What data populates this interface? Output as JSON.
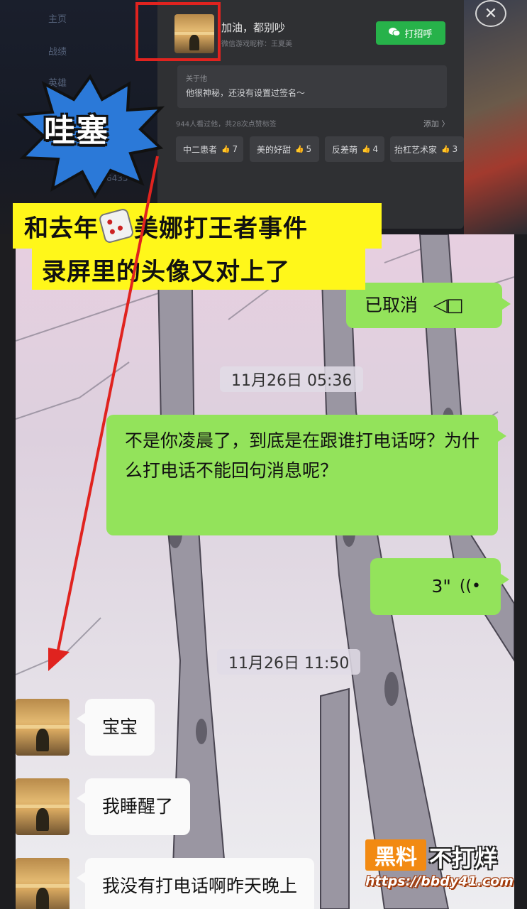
{
  "background_menu": [
    "主页",
    "战绩",
    "英雄"
  ],
  "background_number": "6435",
  "profile_popup": {
    "name": "加油，都别吵",
    "sub_label": "微信游戏昵称：王夏美",
    "greet_button": "打招呼",
    "about_title": "关于他",
    "about_text": "他很神秘，还没有设置过签名～",
    "visits_text": "944人看过他，共28次点赞标签",
    "add_link": "添加 〉",
    "tags": [
      {
        "label": "中二患者",
        "count": "7"
      },
      {
        "label": "美的好甜",
        "count": "5"
      },
      {
        "label": "反差萌",
        "count": "4"
      },
      {
        "label": "抬杠艺术家",
        "count": "3"
      }
    ],
    "close_symbol": "✕"
  },
  "sticker_text": "哇塞",
  "caption": {
    "line1_a": "和去年",
    "line1_b": "美娜打王者事件",
    "line2": "录屏里的头像又对上了"
  },
  "chat": {
    "cancelled_call": "已取消",
    "time1": "11月26日 05:36",
    "question_message": "不是你凌晨了，到底是在跟谁打电话呀？为什么打电话不能回句消息呢？",
    "voice_duration": "3\"",
    "time2": "11月26日 11:50",
    "incoming": [
      "宝宝",
      "我睡醒了",
      "我没有打电话啊昨天晚上"
    ]
  },
  "watermark": {
    "box": "黑料",
    "name": "不打烊",
    "url": "https://bbdy41.com"
  },
  "colors": {
    "green_bubble": "#93e35b",
    "highlight_red": "#e0231f",
    "caption_yellow": "#fff71a",
    "greet_green": "#27b24a"
  }
}
